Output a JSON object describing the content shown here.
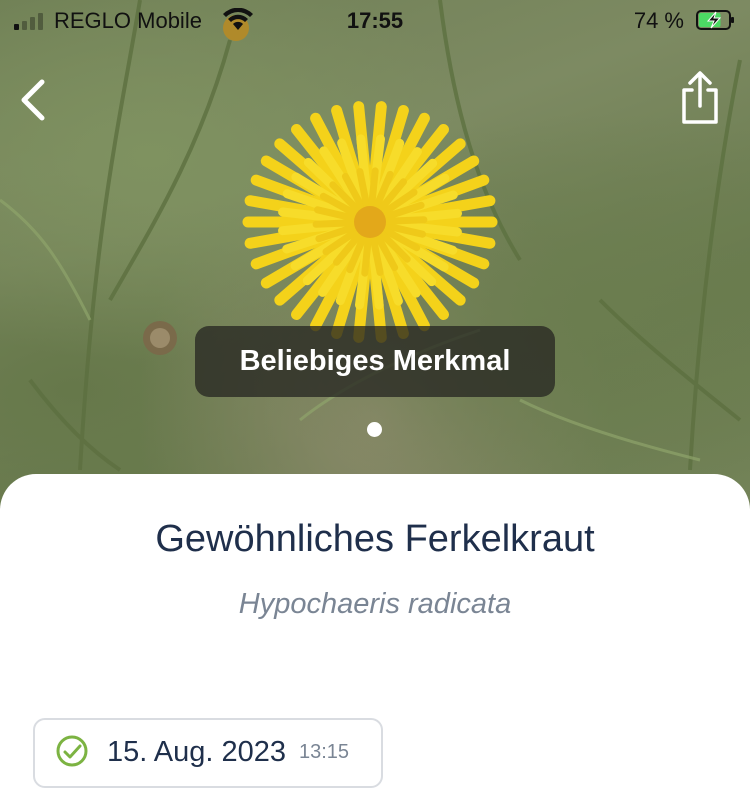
{
  "status_bar": {
    "carrier": "REGLO Mobile",
    "time": "17:55",
    "battery_percent": "74 %",
    "battery_level": 0.74,
    "charging": true,
    "icons": [
      "signal-icon",
      "wifi-icon",
      "battery-charging-icon"
    ]
  },
  "nav": {
    "back_icon": "chevron-left-icon",
    "share_icon": "share-icon"
  },
  "image": {
    "feature_label": "Beliebiges Merkmal",
    "page_count": 1,
    "current_page": 1
  },
  "species": {
    "common_name": "Gewöhnliches Ferkelkraut",
    "scientific_name": "Hypochaeris radicata"
  },
  "observation": {
    "date": "15. Aug. 2023",
    "time": "13:15",
    "status_icon": "verified-check-icon"
  },
  "colors": {
    "title_text": "#1f2f4b",
    "secondary_text": "#7a8594",
    "verified_green": "#7cb342",
    "charging_green": "#4cd964"
  }
}
